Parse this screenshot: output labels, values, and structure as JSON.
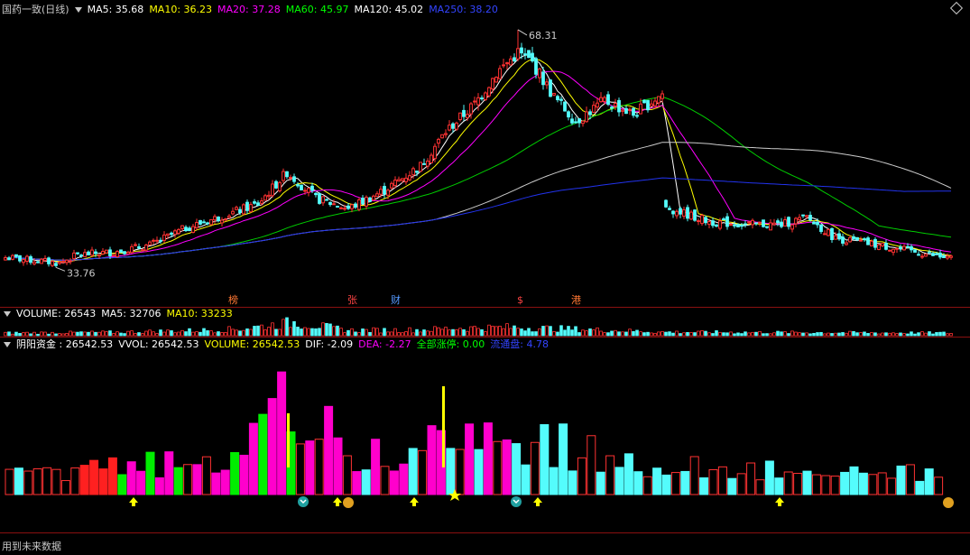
{
  "window": {
    "title": "国药一致(日线)"
  },
  "price_header": {
    "items": [
      {
        "label": "MA5: 35.68",
        "color": "#ffffff"
      },
      {
        "label": "MA10: 36.23",
        "color": "#ffff00"
      },
      {
        "label": "MA20: 37.28",
        "color": "#ff00ff"
      },
      {
        "label": "MA60: 45.97",
        "color": "#00ff00"
      },
      {
        "label": "MA120: 45.02",
        "color": "#ffffff"
      },
      {
        "label": "MA250: 38.20",
        "color": "#3344ff"
      }
    ]
  },
  "volume_header": {
    "items": [
      {
        "label": "VOLUME: 26543",
        "color": "#ffffff"
      },
      {
        "label": "MA5: 32706",
        "color": "#ffffff"
      },
      {
        "label": "MA10: 33233",
        "color": "#ffff00"
      }
    ]
  },
  "indicator_header": {
    "items": [
      {
        "label": "阴阳资金 : 26542.53",
        "color": "#ffffff"
      },
      {
        "label": "VVOL: 26542.53",
        "color": "#ffffff"
      },
      {
        "label": "VOLUME: 26542.53",
        "color": "#ffff00"
      },
      {
        "label": "DIF: -2.09",
        "color": "#ffffff"
      },
      {
        "label": "DEA: -2.27",
        "color": "#ff00ff"
      },
      {
        "label": "全部涨停: 0.00",
        "color": "#00ff00"
      },
      {
        "label": "流通盘: 4.78",
        "color": "#3344ff"
      }
    ]
  },
  "annotations": {
    "high_label": "68.31",
    "low_label": "33.76",
    "markers": [
      {
        "text": "榜",
        "color": "#ff7733"
      },
      {
        "text": "张",
        "color": "#ff4444"
      },
      {
        "text": "财",
        "color": "#5599ff"
      },
      {
        "text": "$",
        "color": "#ff4444"
      },
      {
        "text": "港",
        "color": "#ff7733"
      }
    ]
  },
  "footer": {
    "text": "用到未来数据"
  },
  "colors": {
    "up": "#ff3232",
    "down": "#54fcfc",
    "ma5": "#ffffff",
    "ma10": "#ffff00",
    "ma20": "#ff00ff",
    "ma60": "#00cc00",
    "ma120": "#cccccc",
    "ma250": "#2233ee",
    "vol_magenta": "#ff00cc",
    "vol_green": "#00ee00",
    "vol_cyan": "#54fcfc",
    "vol_red": "#ff2020",
    "vol_yellow": "#ffff00"
  },
  "chart_data": {
    "type": "candlestick",
    "ylim": [
      30,
      70
    ],
    "high": 68.31,
    "low": 33.76,
    "key_closes": [
      {
        "i": 0,
        "v": 35.2
      },
      {
        "i": 15,
        "v": 34.4
      },
      {
        "i": 20,
        "v": 35.6
      },
      {
        "i": 30,
        "v": 36.0
      },
      {
        "i": 40,
        "v": 37.0
      },
      {
        "i": 50,
        "v": 39.5
      },
      {
        "i": 60,
        "v": 41.2
      },
      {
        "i": 70,
        "v": 43.0
      },
      {
        "i": 78,
        "v": 47.6
      },
      {
        "i": 86,
        "v": 43.8
      },
      {
        "i": 95,
        "v": 42.3
      },
      {
        "i": 105,
        "v": 45.0
      },
      {
        "i": 115,
        "v": 48.5
      },
      {
        "i": 122,
        "v": 53.5
      },
      {
        "i": 130,
        "v": 57.5
      },
      {
        "i": 136,
        "v": 62.0
      },
      {
        "i": 142,
        "v": 65.0
      },
      {
        "i": 146,
        "v": 63.5
      },
      {
        "i": 152,
        "v": 58.5
      },
      {
        "i": 158,
        "v": 55.0
      },
      {
        "i": 166,
        "v": 58.0
      },
      {
        "i": 174,
        "v": 56.0
      },
      {
        "i": 182,
        "v": 59.0
      },
      {
        "i": 183,
        "v": 42.5
      },
      {
        "i": 195,
        "v": 40.4
      },
      {
        "i": 205,
        "v": 40.0
      },
      {
        "i": 215,
        "v": 40.0
      },
      {
        "i": 222,
        "v": 41.0
      },
      {
        "i": 230,
        "v": 38.0
      },
      {
        "i": 245,
        "v": 36.7
      },
      {
        "i": 262,
        "v": 35.0
      }
    ],
    "volume_pattern": [
      {
        "i": 0,
        "v": 30
      },
      {
        "i": 30,
        "v": 38
      },
      {
        "i": 55,
        "v": 60
      },
      {
        "i": 65,
        "v": 75
      },
      {
        "i": 80,
        "v": 150
      },
      {
        "i": 95,
        "v": 60
      },
      {
        "i": 115,
        "v": 65
      },
      {
        "i": 125,
        "v": 85
      },
      {
        "i": 140,
        "v": 95
      },
      {
        "i": 160,
        "v": 70
      },
      {
        "i": 183,
        "v": 40
      },
      {
        "i": 262,
        "v": 30
      }
    ],
    "bar_count": 263
  }
}
